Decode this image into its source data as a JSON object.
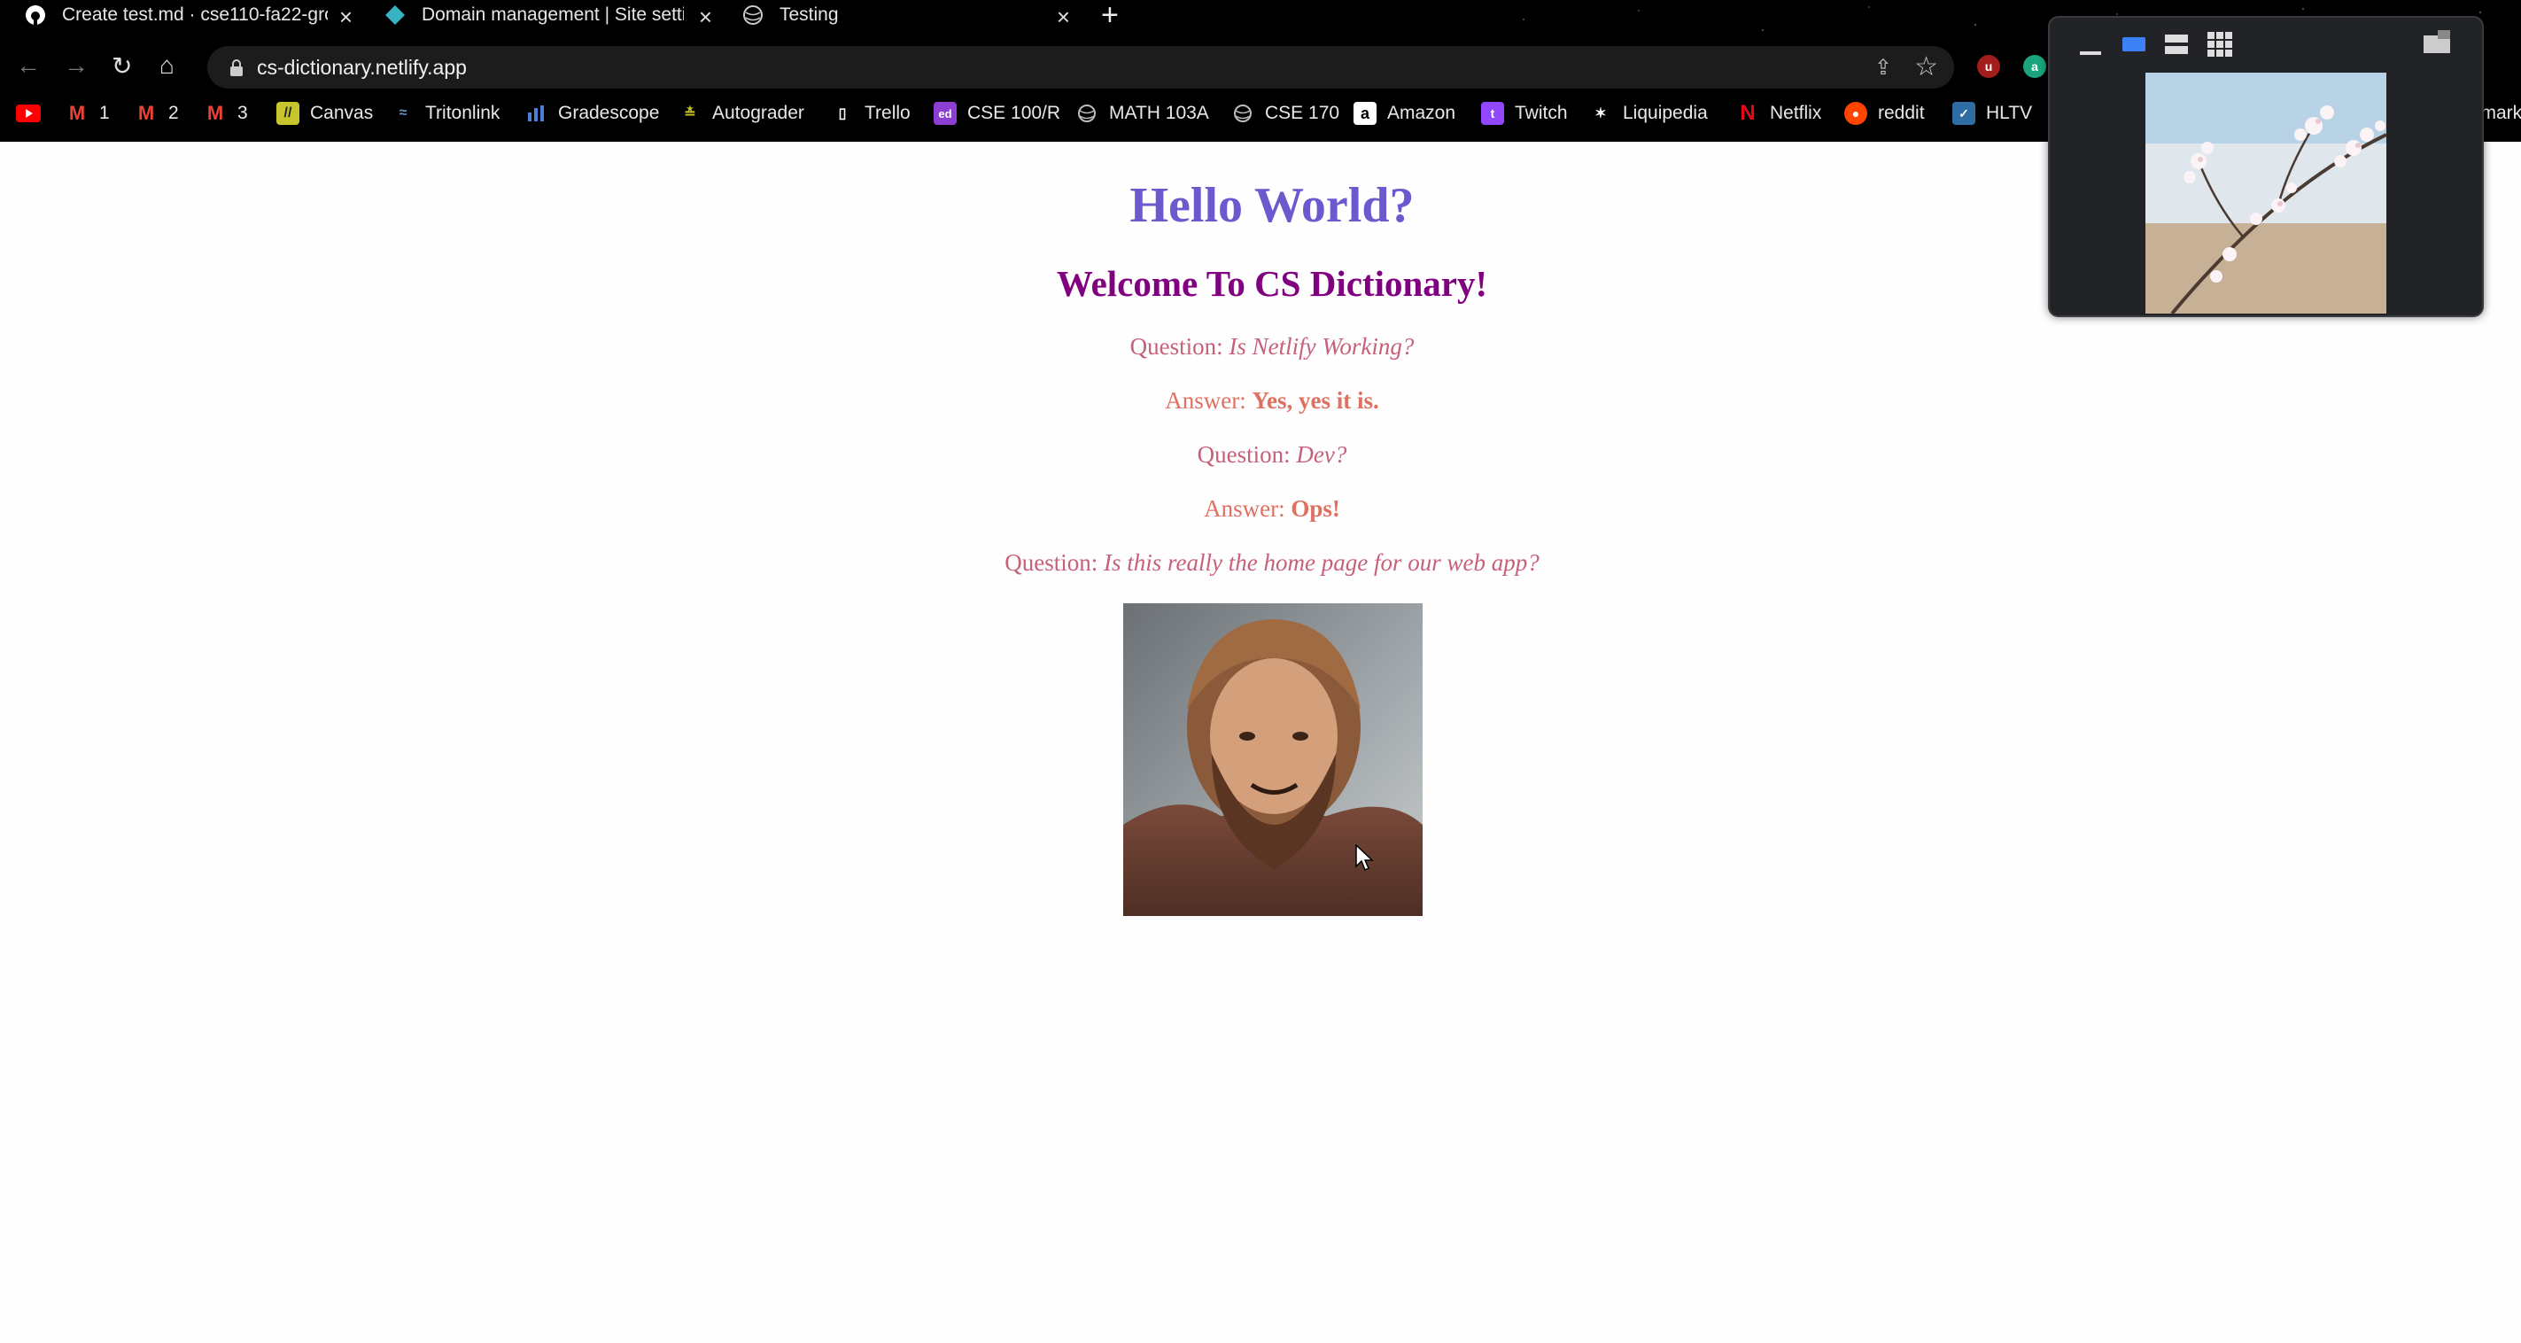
{
  "browser": {
    "tabs": [
      {
        "label": "Create test.md · cse110-fa22-gro",
        "favicon": "github-icon",
        "active": false
      },
      {
        "label": "Domain management | Site settir",
        "favicon": "netlify-icon",
        "active": false
      },
      {
        "label": "Testing",
        "favicon": "globe-icon",
        "active": true
      }
    ],
    "url": "cs-dictionary.netlify.app",
    "bookmarks": [
      {
        "label": "",
        "icon": "youtube-icon",
        "color": "#ff0000"
      },
      {
        "label": "1",
        "icon": "gmail-icon",
        "color": "#ea4335"
      },
      {
        "label": "2",
        "icon": "gmail-icon",
        "color": "#ea4335"
      },
      {
        "label": "3",
        "icon": "gmail-icon",
        "color": "#ea4335"
      },
      {
        "label": "Canvas",
        "icon": "canvas-icon",
        "color": "#c7c52b"
      },
      {
        "label": "Tritonlink",
        "icon": "triton-icon",
        "color": "#6b93c9"
      },
      {
        "label": "Gradescope",
        "icon": "gradescope-icon",
        "color": "#4c7fd8"
      },
      {
        "label": "Autograder",
        "icon": "autograder-icon",
        "color": "#c7c52b"
      },
      {
        "label": "Trello",
        "icon": "trello-icon",
        "color": "#ffffff"
      },
      {
        "label": "CSE 100/R",
        "icon": "ed-icon",
        "color": "#8c3fd1"
      },
      {
        "label": "MATH 103A",
        "icon": "globe-icon",
        "color": "#bbbbbb"
      },
      {
        "label": "CSE 170",
        "icon": "globe-icon",
        "color": "#bbbbbb"
      },
      {
        "label": "Amazon",
        "icon": "amazon-icon",
        "color": "#ffffff"
      },
      {
        "label": "Twitch",
        "icon": "twitch-icon",
        "color": "#9146ff"
      },
      {
        "label": "Liquipedia",
        "icon": "liquipedia-icon",
        "color": "#ffffff"
      },
      {
        "label": "Netflix",
        "icon": "netflix-icon",
        "color": "#e50914"
      },
      {
        "label": "reddit",
        "icon": "reddit-icon",
        "color": "#ff4500"
      },
      {
        "label": "HLTV",
        "icon": "hltv-icon",
        "color": "#2d6da3"
      },
      {
        "label": "kmark",
        "icon": "",
        "color": ""
      }
    ]
  },
  "page": {
    "title": "Hello World?",
    "subtitle": "Welcome To CS Dictionary!",
    "qa": [
      {
        "kind": "question",
        "prefix": "Question:",
        "text": "Is Netlify Working?"
      },
      {
        "kind": "answer",
        "prefix": "Answer:",
        "text": "Yes, yes it is."
      },
      {
        "kind": "question",
        "prefix": "Question:",
        "text": "Dev?"
      },
      {
        "kind": "answer",
        "prefix": "Answer:",
        "text": "Ops!"
      },
      {
        "kind": "question",
        "prefix": "Question:",
        "text": "Is this really the home page for our web app?"
      }
    ],
    "image": "bearded-man-nodding-gif"
  },
  "pip_panel": {
    "layout_icons": [
      "minimize-icon",
      "single-layout-icon",
      "rows-layout-icon",
      "grid-layout-icon",
      "expand-icon"
    ],
    "thumbnail": "cherry-blossom-branch"
  }
}
